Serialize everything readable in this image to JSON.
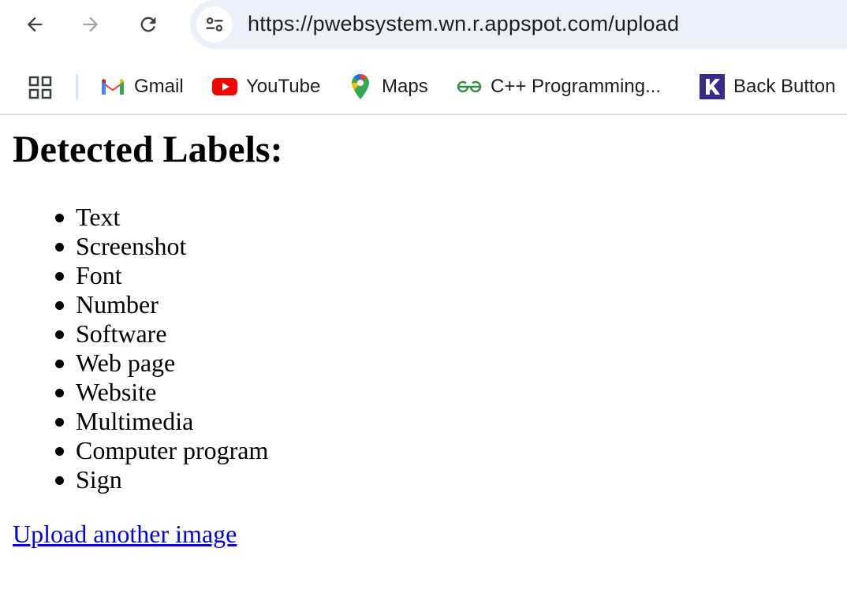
{
  "browser": {
    "url": "https://pwebsystem.wn.r.appspot.com/upload",
    "nav": {
      "back_icon": "arrow-left-icon",
      "forward_icon": "arrow-right-icon",
      "reload_icon": "reload-icon",
      "site_info_icon": "tune-icon"
    },
    "bookmarks": [
      {
        "label": "Gmail",
        "icon": "gmail-icon"
      },
      {
        "label": "YouTube",
        "icon": "youtube-icon"
      },
      {
        "label": "Maps",
        "icon": "maps-pin-icon"
      },
      {
        "label": "C++ Programming...",
        "icon": "geeksforgeeks-icon"
      },
      {
        "label": "Back Button",
        "icon": "k-logo-icon"
      }
    ],
    "colors": {
      "omnibox_bg": "#ebf0f8",
      "forward_disabled": "#a0a4a8",
      "link": "#0000ee"
    }
  },
  "page": {
    "heading": "Detected Labels:",
    "labels": [
      "Text",
      "Screenshot",
      "Font",
      "Number",
      "Software",
      "Web page",
      "Website",
      "Multimedia",
      "Computer program",
      "Sign"
    ],
    "upload_link": "Upload another image"
  }
}
